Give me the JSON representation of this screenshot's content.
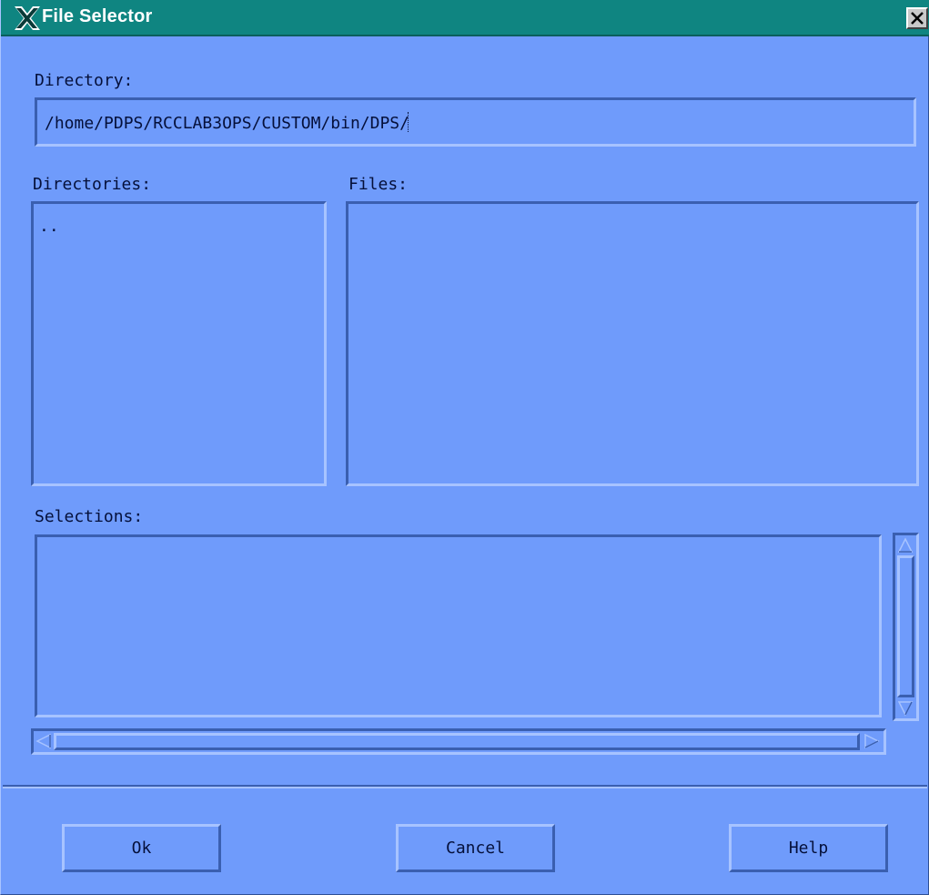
{
  "window": {
    "title": "File Selector",
    "close_icon": "close-icon",
    "app_icon": "x-window-logo-icon"
  },
  "directory": {
    "label": "Directory:",
    "value": "/home/PDPS/RCCLAB3OPS/CUSTOM/bin/DPS/"
  },
  "directories": {
    "label": "Directories:",
    "items": [
      ".."
    ]
  },
  "files": {
    "label": "Files:",
    "items": []
  },
  "selections": {
    "label": "Selections:",
    "items": []
  },
  "buttons": {
    "ok": "Ok",
    "cancel": "Cancel",
    "help": "Help"
  },
  "colors": {
    "background": "#6f9bfb",
    "titlebar": "#0f8581",
    "text": "#05103a"
  }
}
